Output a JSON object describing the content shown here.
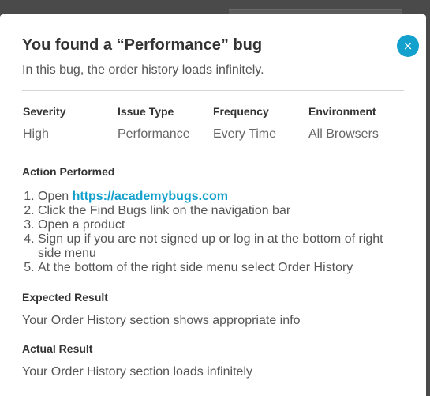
{
  "modal": {
    "title": "You found a “Performance” bug",
    "subtitle": "In this bug, the order history loads infinitely.",
    "close_label": "×"
  },
  "details": [
    {
      "label": "Severity",
      "value": "High"
    },
    {
      "label": "Issue Type",
      "value": "Performance"
    },
    {
      "label": "Frequency",
      "value": "Every Time"
    },
    {
      "label": "Environment",
      "value": "All Browsers"
    }
  ],
  "action_performed": {
    "heading": "Action Performed",
    "step1_prefix": "Open ",
    "step1_link": "https://academybugs.com",
    "steps": [
      "Click the Find Bugs link on the navigation bar",
      "Open a product",
      "Sign up if you are not signed up or log in at the bottom of right side menu",
      "At the bottom of the right side menu select Order History"
    ]
  },
  "expected_result": {
    "heading": "Expected Result",
    "text": "Your Order History section shows appropriate info"
  },
  "actual_result": {
    "heading": "Actual Result",
    "text": "Your Order History section loads infinitely"
  },
  "colors": {
    "accent": "#12a0cc",
    "backdrop": "#4a4a4a"
  }
}
